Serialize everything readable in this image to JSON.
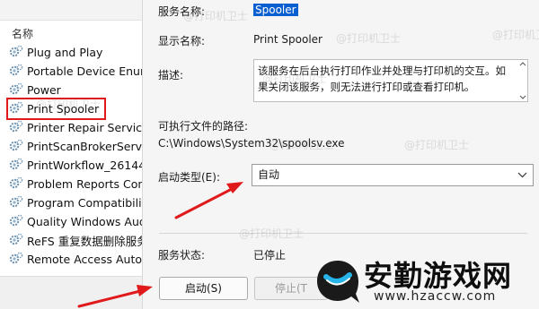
{
  "services_list": {
    "column_header": "名称",
    "items": [
      {
        "label": "Plug and Play"
      },
      {
        "label": "Portable Device Enum"
      },
      {
        "label": "Power"
      },
      {
        "label": "Print Spooler"
      },
      {
        "label": "Printer Repair Service"
      },
      {
        "label": "PrintScanBrokerService"
      },
      {
        "label": "PrintWorkflow_26144"
      },
      {
        "label": "Problem Reports Con"
      },
      {
        "label": "Program Compatibilit"
      },
      {
        "label": "Quality Windows Aud"
      },
      {
        "label": "ReFS 重复数据删除服务"
      },
      {
        "label": "Remote Access Auto"
      }
    ],
    "selected_index": 3
  },
  "properties": {
    "service_name_label": "服务名称:",
    "service_name_value": "Spooler",
    "display_name_label": "显示名称:",
    "display_name_value": "Print Spooler",
    "description_label": "描述:",
    "description_line1": "该服务在后台执行打印作业并处理与打印机的交互。如",
    "description_line2": "果关闭该服务，则无法进行打印或查看打印机。",
    "exe_path_label": "可执行文件的路径:",
    "exe_path_value": "C:\\Windows\\System32\\spoolsv.exe",
    "startup_type_label": "启动类型(E):",
    "startup_type_value": "自动",
    "status_label": "服务状态:",
    "status_value": "已停止",
    "start_button": "启动(S)",
    "stop_button": "停止(T"
  },
  "watermarks": {
    "text": "@打印机卫士"
  },
  "logo": {
    "name": "安勤游戏网",
    "url": "www.hzaccw.com"
  },
  "colors": {
    "highlight_box": "#e0191b",
    "arrow": "#e0191b",
    "selection": "#0a5fd0"
  },
  "icons": {
    "service": "service-gear-icon",
    "dropdown": "chevron-down-icon",
    "logo": "logo-q-icon"
  }
}
